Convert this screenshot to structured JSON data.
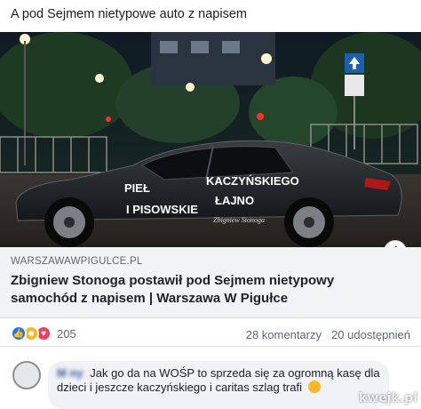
{
  "post": {
    "text": "A pod Sejmem nietypowe auto z napisem"
  },
  "media": {
    "car_text_line1": "PIEŁ",
    "car_text_line2": "KACZYŃSKIEGO",
    "car_text_line3": "I PISOWSKIE",
    "car_text_line4": "ŁAJNO",
    "car_signature": "Zbigniew Stonoga"
  },
  "link_preview": {
    "domain": "WARSZAWAWPIGULCE.PL",
    "title": "Zbigniew Stonoga postawił pod Sejmem nietypowy samochód z napisem | Warszawa W Pigułce"
  },
  "stats": {
    "reaction_count": "205",
    "comments": "28 komentarzy",
    "shares": "20 udostępnień"
  },
  "comment": {
    "author": "M         ny",
    "text": "Jak go da na WOŚP to sprzeda się za ogromną kasę dla dzieci i jeszcze kaczyńskiego i caritas szlag trafi"
  },
  "watermark": "kwejk.pl",
  "colors": {
    "link_bg": "#f2f3f5",
    "like": "#1877f2",
    "haha": "#f7b928",
    "love": "#f33e58"
  }
}
